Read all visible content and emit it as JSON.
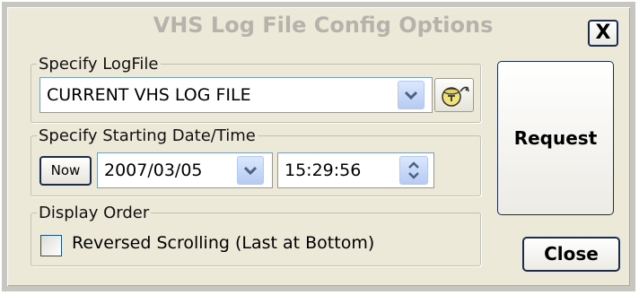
{
  "window": {
    "title": "VHS Log File Config Options",
    "close_x_label": "X"
  },
  "logfile_group": {
    "legend": "Specify LogFile",
    "selected_value": "CURRENT VHS LOG FILE",
    "dropdown_icon": "chevron-down-icon",
    "browse_icon": "open-folder-icon"
  },
  "start_group": {
    "legend": "Specify Starting Date/Time",
    "now_label": "Now",
    "date_value": "2007/03/05",
    "time_value": "15:29:56",
    "spinner_icon": "up-down-spinner-icon"
  },
  "order_group": {
    "legend": "Display Order",
    "checkbox_label": "Reversed Scrolling (Last at Bottom)",
    "checked": false
  },
  "actions": {
    "request_label": "Request",
    "close_label": "Close"
  },
  "colors": {
    "dialog_background": "#ece9d8",
    "title_text": "#b5b3ab",
    "button_border": "#1c2c4e",
    "dropdown_button": "#c6d7f8"
  }
}
